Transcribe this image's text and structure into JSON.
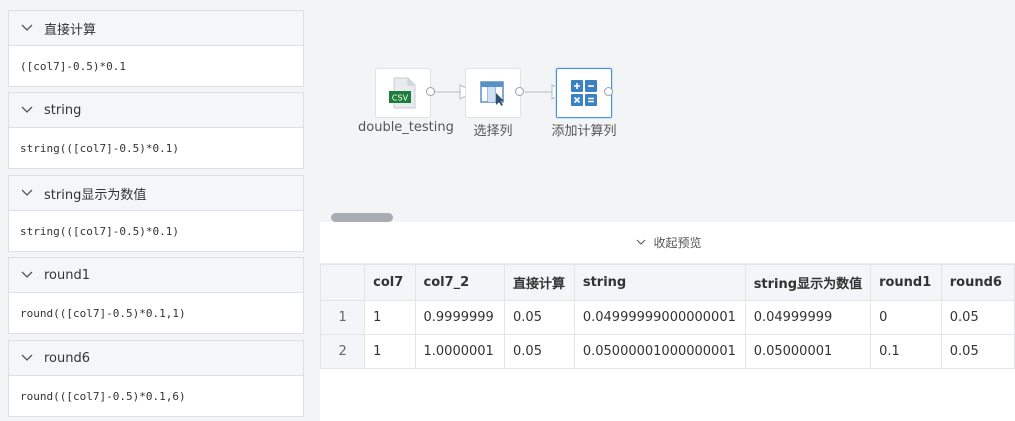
{
  "cards": [
    {
      "title": "直接计算",
      "expr": "([col7]-0.5)*0.1"
    },
    {
      "title": "string",
      "expr": "string(([col7]-0.5)*0.1)"
    },
    {
      "title": "string显示为数值",
      "expr": "string(([col7]-0.5)*0.1)"
    },
    {
      "title": "round1",
      "expr": "round(([col7]-0.5)*0.1,1)"
    },
    {
      "title": "round6",
      "expr": "round(([col7]-0.5)*0.1,6)"
    }
  ],
  "nodes": [
    {
      "label": "double_testing",
      "icon": "csv-file-icon",
      "icon_text": "CSV"
    },
    {
      "label": "选择列",
      "icon": "select-columns-icon"
    },
    {
      "label": "添加计算列",
      "icon": "calculator-icon"
    }
  ],
  "preview": {
    "collapse_label": "收起预览",
    "columns": [
      "",
      "col7",
      "col7_2",
      "直接计算",
      "string",
      "string显示为数值",
      "round1",
      "round6"
    ],
    "rows": [
      [
        "1",
        "1",
        "0.9999999",
        "0.05",
        "0.04999999000000001",
        "0.04999999",
        "0",
        "0.05"
      ],
      [
        "2",
        "1",
        "1.0000001",
        "0.05",
        "0.05000001000000001",
        "0.05000001",
        "0.1",
        "0.05"
      ]
    ]
  },
  "colors": {
    "accent": "#4a90e2",
    "csv_green": "#1e7d3a",
    "calc_blue": "#3b82c4"
  }
}
